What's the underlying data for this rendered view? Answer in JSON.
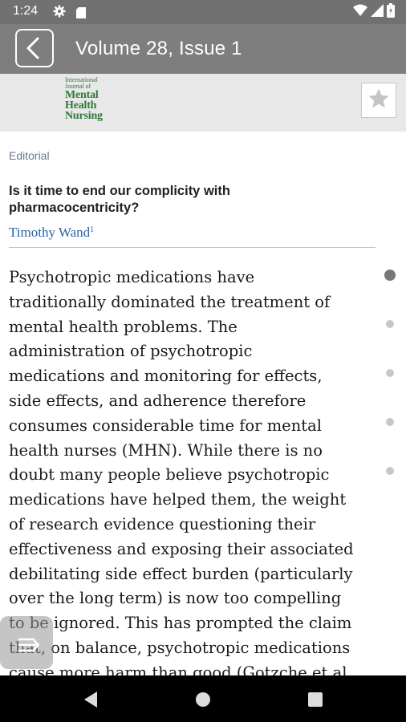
{
  "status_bar": {
    "time": "1:24",
    "icons": [
      "gear-icon",
      "sd-card-icon",
      "wifi-icon",
      "signal-icon",
      "battery-icon"
    ]
  },
  "header": {
    "title": "Volume 28, Issue 1",
    "back_icon": "chevron-left-icon"
  },
  "journal": {
    "logo_line_1": "International",
    "logo_line_2": "Journal of",
    "logo_line_3": "Mental",
    "logo_line_4": "Health",
    "logo_line_5": "Nursing",
    "favorite_icon": "star-icon"
  },
  "article": {
    "section": "Editorial",
    "title_line_1": "Is it time to end our complicity with",
    "title_line_2": "pharmacocentricity?",
    "author": "Timothy Wand",
    "author_sup": "1",
    "body_lines": [
      "Psychotropic medications have",
      "traditionally dominated the treatment of",
      "mental health problems. The",
      "administration of psychotropic",
      "medications and monitoring for effects,",
      "side effects, and adherence therefore",
      "consumes considerable time for mental",
      "health nurses (MHN). While there is no",
      "doubt many people believe psychotropic",
      "medications have helped them, the weight",
      "of research evidence questioning their",
      "effectiveness and exposing their associated",
      "debilitating side effect burden (particularly",
      "over the long term) is now too compelling",
      "to be ignored. This has prompted the claim",
      "that, on balance, psychotropic medications",
      "cause more harm than good (Gotzche et al."
    ]
  },
  "page_indicator": {
    "count": 5,
    "active_index": 0
  },
  "toc_button": {
    "icon": "toc-arrow-icon"
  },
  "nav_bar": {
    "icons": [
      "back-triangle-icon",
      "home-circle-icon",
      "recents-square-icon"
    ]
  },
  "colors": {
    "status_bar": "#717171",
    "header": "#7e7e7e",
    "banner": "#e8e8e8",
    "link": "#2a63a8",
    "section_label": "#6a7a92",
    "logo_green": "#2f7a3c"
  }
}
